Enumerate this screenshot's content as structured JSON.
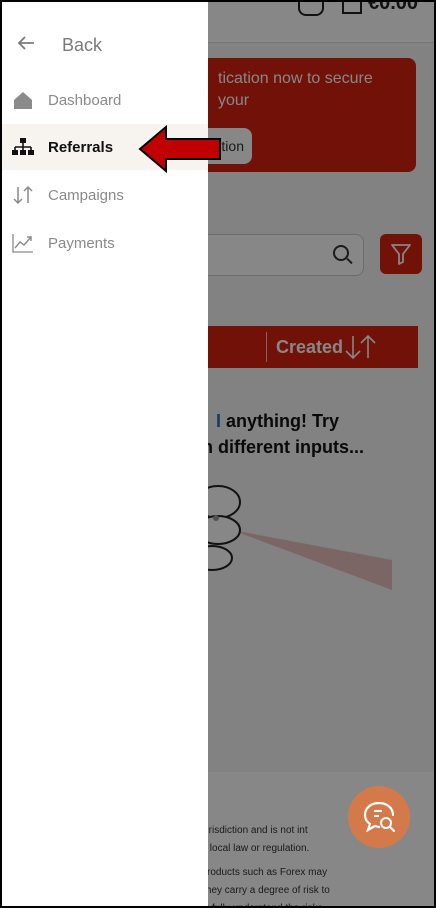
{
  "header": {
    "balance": "€0.00"
  },
  "verification_banner": {
    "message": "tication now to secure your",
    "button_label": "tion"
  },
  "table": {
    "created_header": "Created"
  },
  "empty_state": {
    "highlight": "I",
    "line1_rest": " anything! Try",
    "line2": "n different inputs..."
  },
  "footer": {
    "disclaimer": [
      "any jurisdiction and is not int",
      "ary to local law or regulation.",
      "ged products such as Forex may",
      "s as they carry a degree of risk to",
      "at you fully understand the risks"
    ]
  },
  "drawer": {
    "back_label": "Back",
    "items": [
      {
        "label": "Dashboard",
        "icon": "home-icon",
        "active": false
      },
      {
        "label": "Referrals",
        "icon": "sitemap-icon",
        "active": true
      },
      {
        "label": "Campaigns",
        "icon": "sort-arrows-icon",
        "active": false
      },
      {
        "label": "Payments",
        "icon": "trend-chart-icon",
        "active": false
      }
    ]
  },
  "colors": {
    "brand_red": "#d8210f",
    "annotation_arrow": "#c00000",
    "chat_button": "#d47a4a",
    "active_item_bg": "#f7f3ef"
  }
}
